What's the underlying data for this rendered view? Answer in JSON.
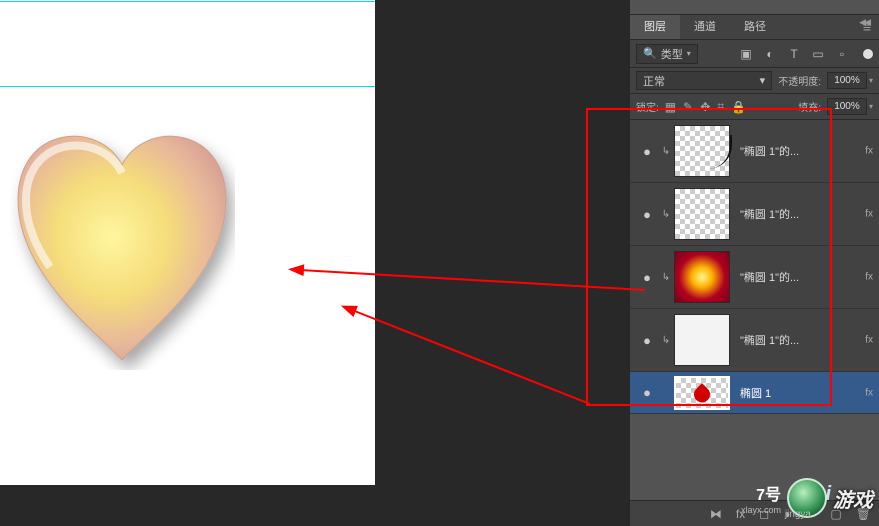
{
  "tabs": {
    "layers": "图层",
    "channels": "通道",
    "paths": "路径"
  },
  "filter": {
    "label": "类型"
  },
  "blend": {
    "mode": "正常",
    "opacity_label": "不透明度:",
    "opacity_value": "100%"
  },
  "lock": {
    "label": "锁定:",
    "fill_label": "填充:",
    "fill_value": "100%"
  },
  "layers": [
    {
      "name": "\"椭圆 1\"的..."
    },
    {
      "name": "\"椭圆 1\"的..."
    },
    {
      "name": "\"椭圆 1\"的..."
    },
    {
      "name": "\"椭圆 1\"的..."
    },
    {
      "name": "椭圆 1"
    }
  ],
  "icons": {
    "eye": "●",
    "search": "🔍",
    "image": "▣",
    "adjust": "◐",
    "type": "T",
    "shape": "▭",
    "smart": "▫",
    "chevron": "▾",
    "menu": "≡",
    "trans": "▦",
    "brush": "✎",
    "move": "✥",
    "crop": "⌗",
    "lock_i": "🔒",
    "fx": "fx",
    "link": "⧓",
    "mask": "◻",
    "adj": "◑",
    "folder": "🗀",
    "new": "▢",
    "trash": "🗑"
  },
  "watermark": {
    "main": "游戏",
    "alt": "7号",
    "sub": "jingya",
    "url": "xlayx.com",
    "baidu": "Bai"
  }
}
